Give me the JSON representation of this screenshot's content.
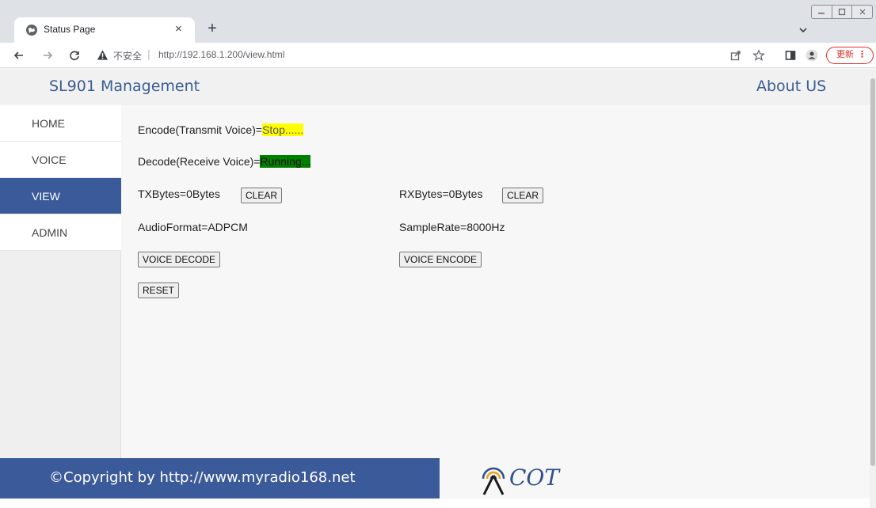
{
  "browser": {
    "tab_title": "Status Page",
    "new_tab_symbol": "+",
    "close_symbol": "×",
    "security_label": "不安全",
    "address_separator": "|",
    "url": "http://192.168.1.200/view.html",
    "update_label": "更新",
    "update_menu_symbol": "⋮"
  },
  "site": {
    "title": "SL901 Management",
    "about_label": "About US",
    "accent_color": "#3b5a9a"
  },
  "sidebar": {
    "items": [
      {
        "label": "HOME",
        "active": false
      },
      {
        "label": "VOICE",
        "active": false
      },
      {
        "label": "VIEW",
        "active": true
      },
      {
        "label": "ADMIN",
        "active": false
      }
    ]
  },
  "status": {
    "encode_label": "Encode(Transmit Voice)=",
    "encode_value": "Stop......",
    "decode_label": "Decode(Receive Voice)=",
    "decode_value": "Running...",
    "tx_bytes": "TXBytes=0Bytes",
    "rx_bytes": "RXBytes=0Bytes",
    "clear_label": "CLEAR",
    "audio_format": "AudioFormat=ADPCM",
    "sample_rate": "SampleRate=8000Hz",
    "voice_decode_label": "VOICE DECODE",
    "voice_encode_label": "VOICE ENCODE",
    "reset_label": "RESET"
  },
  "footer": {
    "copyright": "©Copyright by http://www.myradio168.net",
    "logo_text": "COT"
  }
}
